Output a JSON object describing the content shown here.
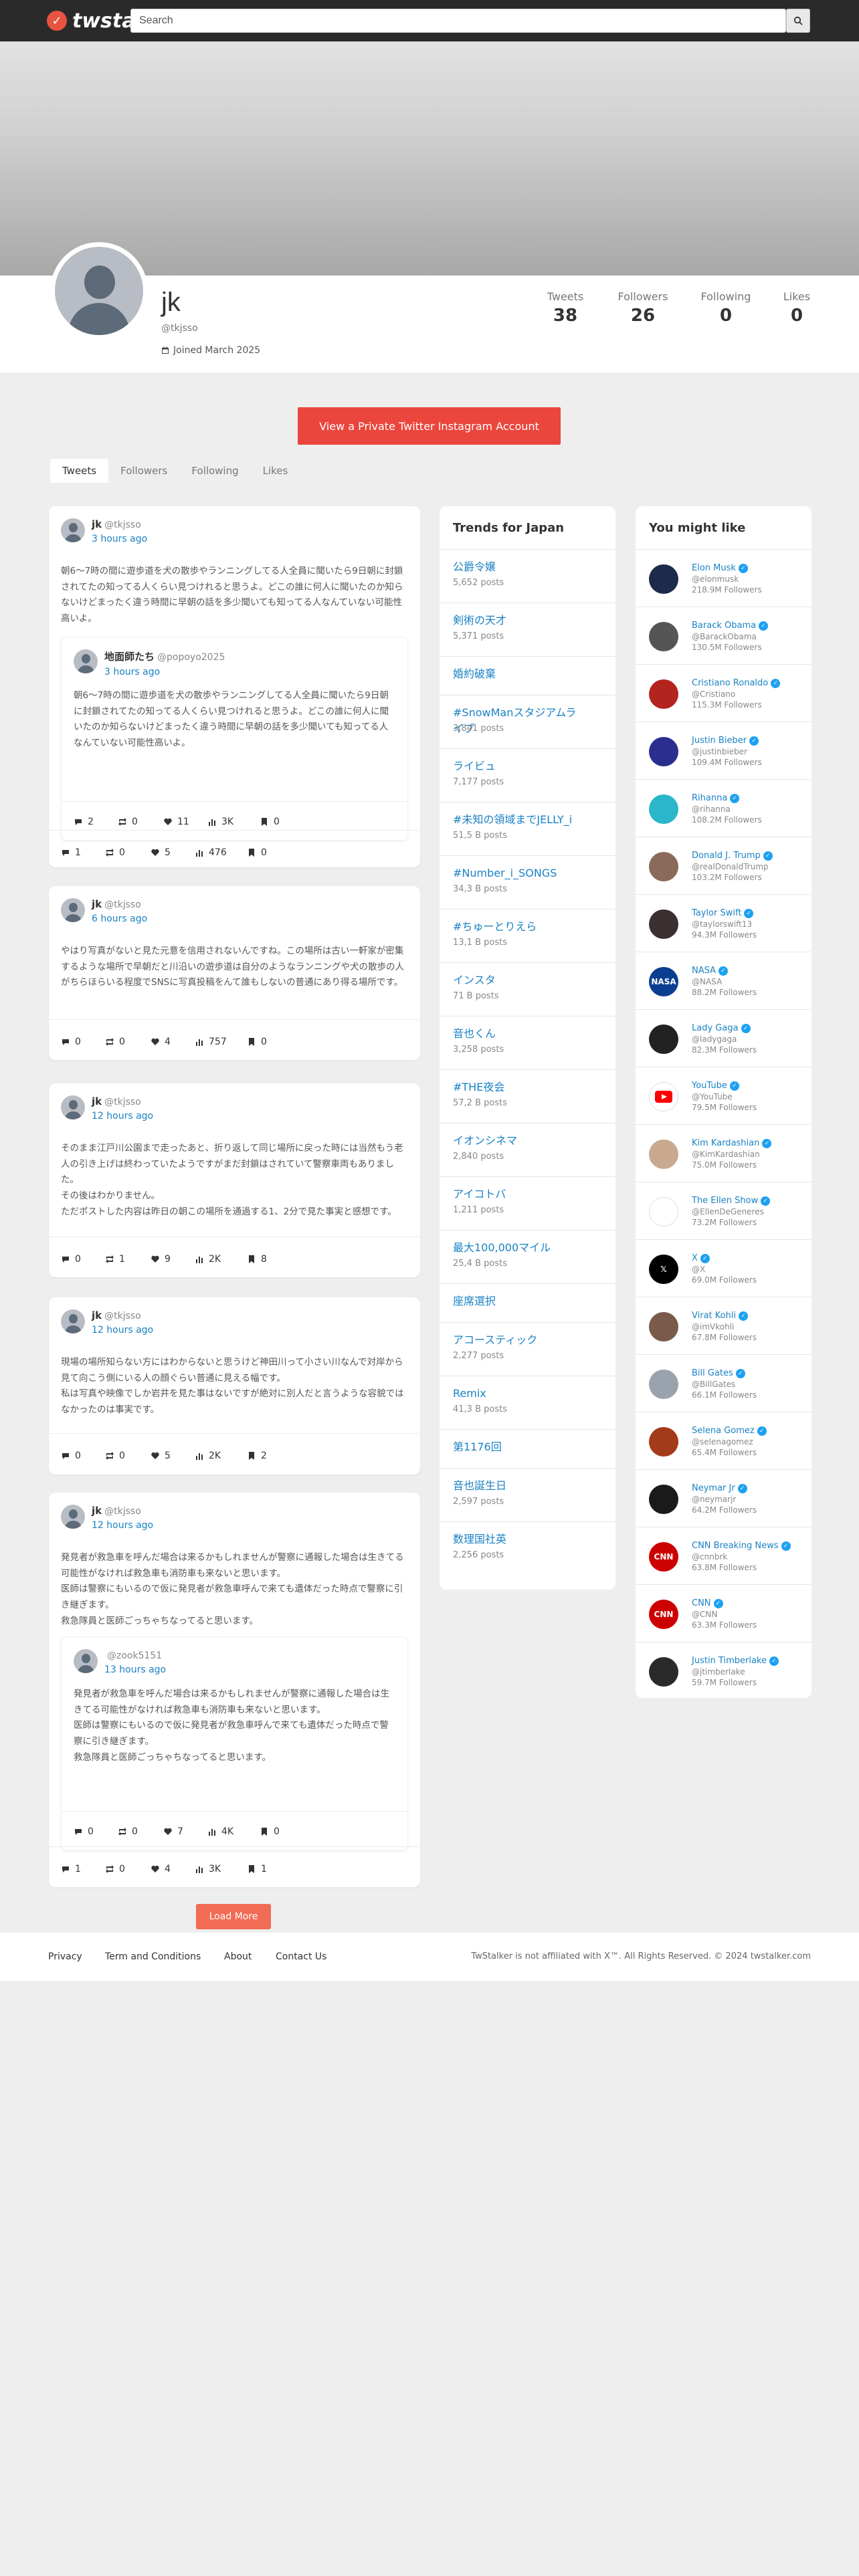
{
  "header": {
    "logo_text": "twstalker",
    "search_placeholder": "Search",
    "search_icon": "search-icon"
  },
  "profile": {
    "name": "jk",
    "handle": "@tkjsso",
    "joined": "Joined March 2025",
    "stats": [
      {
        "label": "Tweets",
        "value": "38"
      },
      {
        "label": "Followers",
        "value": "26"
      },
      {
        "label": "Following",
        "value": "0"
      },
      {
        "label": "Likes",
        "value": "0"
      }
    ]
  },
  "cta": "View a Private Twitter Instagram Account",
  "tabs": [
    "Tweets",
    "Followers",
    "Following",
    "Likes"
  ],
  "tweets": [
    {
      "name": "jk",
      "handle": "@tkjsso",
      "time": "3 hours ago",
      "text": "朝6〜7時の間に遊歩道を犬の散歩やランニングしてる人全員に聞いたら9日朝に封鎖されてたの知ってる人くらい見つけれると思うよ。どこの誰に何人に聞いたのか知らないけどまったく違う時間に早朝の話を多少聞いても知ってる人なんていない可能性高いよ。",
      "quote": {
        "name": "地面師たち",
        "handle": "@popoyo2025",
        "time": "3 hours ago",
        "text": "朝6〜7時の間に遊歩道を犬の散歩やランニングしてる人全員に聞いたら9日朝に封鎖されてたの知ってる人くらい見つけれると思うよ。どこの誰に何人に聞いたのか知らないけどまったく違う時間に早朝の話を多少聞いても知ってる人なんていない可能性高いよ。",
        "stats": {
          "replies": "2",
          "retweets": "0",
          "likes": "11",
          "views": "3K",
          "bookmarks": "0"
        }
      },
      "stats": {
        "replies": "1",
        "retweets": "0",
        "likes": "5",
        "views": "476",
        "bookmarks": "0"
      }
    },
    {
      "name": "jk",
      "handle": "@tkjsso",
      "time": "6 hours ago",
      "text": "やはり写真がないと見た元意を信用されないんですね。この場所は古い一軒家が密集するような場所で早朝だと川沿いの遊歩道は自分のようなランニングや犬の散歩の人がちらほらいる程度でSNSに写真投稿をんて誰もしないの普通にあり得る場所です。",
      "stats": {
        "replies": "0",
        "retweets": "0",
        "likes": "4",
        "views": "757",
        "bookmarks": "0"
      }
    },
    {
      "name": "jk",
      "handle": "@tkjsso",
      "time": "12 hours ago",
      "text": "そのまま江戸川公園まで走ったあと、折り返して同じ場所に戻った時には当然もう老人の引き上げは終わっていたようですがまだ封鎖はされていて警察車両もありました。\nその後はわかりません。\nただポストした内容は昨日の朝この場所を通過する1、2分で見た事実と感想です。",
      "stats": {
        "replies": "0",
        "retweets": "1",
        "likes": "9",
        "views": "2K",
        "bookmarks": "8"
      }
    },
    {
      "name": "jk",
      "handle": "@tkjsso",
      "time": "12 hours ago",
      "text": "現場の場所知らない方にはわからないと思うけど神田川って小さい川なんで対岸から見て向こう側にいる人の顔ぐらい普通に見える幅です。\n私は写真や映像でしか岩井を見た事はないですが絶対に別人だと言うような容貌ではなかったのは事実です。",
      "stats": {
        "replies": "0",
        "retweets": "0",
        "likes": "5",
        "views": "2K",
        "bookmarks": "2"
      }
    },
    {
      "name": "jk",
      "handle": "@tkjsso",
      "time": "12 hours ago",
      "text": "発見者が救急車を呼んだ場合は来るかもしれませんが警察に通報した場合は生きてる可能性がなければ救急車も消防車も来ないと思います。\n医師は警察にもいるので仮に発見者が救急車呼んで来ても遺体だった時点で警察に引き継ぎます。\n救急隊員と医師ごっちゃちなってると思います。",
      "quote": {
        "name": "",
        "handle": "@zook5151",
        "time": "13 hours ago",
        "text": "発見者が救急車を呼んだ場合は来るかもしれませんが警察に通報した場合は生きてる可能性がなければ救急車も消防車も来ないと思います。\n医師は警察にもいるので仮に発見者が救急車呼んで来ても遺体だった時点で警察に引き継ぎます。\n救急隊員と医師ごっちゃちなってると思います。",
        "stats": {
          "replies": "0",
          "retweets": "0",
          "likes": "7",
          "views": "4K",
          "bookmarks": "0"
        }
      },
      "stats": {
        "replies": "1",
        "retweets": "0",
        "likes": "4",
        "views": "3K",
        "bookmarks": "1"
      }
    }
  ],
  "trends": {
    "title": "Trends for Japan",
    "items": [
      {
        "name": "公爵令嬢",
        "count": "5,652 posts"
      },
      {
        "name": "剣術の天才",
        "count": "5,371 posts"
      },
      {
        "name": "婚約破棄",
        "count": ""
      },
      {
        "name": "#SnowManスタジアムライブ",
        "count": "3,841 posts"
      },
      {
        "name": "ライビュ",
        "count": "7,177 posts"
      },
      {
        "name": "#未知の領域までJELLY_i",
        "count": "51,5 B posts"
      },
      {
        "name": "#Number_i_SONGS",
        "count": "34,3 B posts"
      },
      {
        "name": "#ちゅーとりえら",
        "count": "13,1 B posts"
      },
      {
        "name": "インスタ",
        "count": "71 B posts"
      },
      {
        "name": "音也くん",
        "count": "3,258 posts"
      },
      {
        "name": "#THE夜会",
        "count": "57,2 B posts"
      },
      {
        "name": "イオンシネマ",
        "count": "2,840 posts"
      },
      {
        "name": "アイコトバ",
        "count": "1,211 posts"
      },
      {
        "name": "最大100,000マイル",
        "count": "25,4 B posts"
      },
      {
        "name": "座席選択",
        "count": ""
      },
      {
        "name": "アコースティック",
        "count": "2,277 posts"
      },
      {
        "name": "Remix",
        "count": "41,3 B posts"
      },
      {
        "name": "第1176回",
        "count": ""
      },
      {
        "name": "音也誕生日",
        "count": "2,597 posts"
      },
      {
        "name": "数理国社英",
        "count": "2,256 posts"
      }
    ]
  },
  "suggestions": {
    "title": "You might like",
    "items": [
      {
        "name": "Elon Musk",
        "handle": "@elonmusk",
        "followers": "218.9M Followers",
        "color": "#1d2a4a"
      },
      {
        "name": "Barack Obama",
        "handle": "@BarackObama",
        "followers": "130.5M Followers",
        "color": "#555555"
      },
      {
        "name": "Cristiano Ronaldo",
        "handle": "@Cristiano",
        "followers": "115.3M Followers",
        "color": "#b3241f"
      },
      {
        "name": "Justin Bieber",
        "handle": "@justinbieber",
        "followers": "109.4M Followers",
        "color": "#2a2f8f"
      },
      {
        "name": "Rihanna",
        "handle": "@rihanna",
        "followers": "108.2M Followers",
        "color": "#2ab7c9"
      },
      {
        "name": "Donald J. Trump",
        "handle": "@realDonaldTrump",
        "followers": "103.2M Followers",
        "color": "#8a6a5a"
      },
      {
        "name": "Taylor Swift",
        "handle": "@taylorswift13",
        "followers": "94.3M Followers",
        "color": "#3a3030"
      },
      {
        "name": "NASA",
        "handle": "@NASA",
        "followers": "88.2M Followers",
        "color": "#0b3d91"
      },
      {
        "name": "Lady Gaga",
        "handle": "@ladygaga",
        "followers": "82.3M Followers",
        "color": "#222222"
      },
      {
        "name": "YouTube",
        "handle": "@YouTube",
        "followers": "79.5M Followers",
        "color": "#ffffff"
      },
      {
        "name": "Kim Kardashian",
        "handle": "@KimKardashian",
        "followers": "75.0M Followers",
        "color": "#c9a98f"
      },
      {
        "name": "The Ellen Show",
        "handle": "@EllenDeGeneres",
        "followers": "73.2M Followers",
        "color": "#ffffff"
      },
      {
        "name": "X",
        "handle": "@X",
        "followers": "69.0M Followers",
        "color": "#000000"
      },
      {
        "name": "Virat Kohli",
        "handle": "@imVkohli",
        "followers": "67.8M Followers",
        "color": "#7a5a4a"
      },
      {
        "name": "Bill Gates",
        "handle": "@BillGates",
        "followers": "66.1M Followers",
        "color": "#9aa3ad"
      },
      {
        "name": "Selena Gomez",
        "handle": "@selenagomez",
        "followers": "65.4M Followers",
        "color": "#a33a1a"
      },
      {
        "name": "Neymar Jr",
        "handle": "@neymarjr",
        "followers": "64.2M Followers",
        "color": "#1a1a1a"
      },
      {
        "name": "CNN Breaking News",
        "handle": "@cnnbrk",
        "followers": "63.8M Followers",
        "color": "#cc0000"
      },
      {
        "name": "CNN",
        "handle": "@CNN",
        "followers": "63.3M Followers",
        "color": "#cc0000"
      },
      {
        "name": "Justin Timberlake",
        "handle": "@jtimberlake",
        "followers": "59.7M Followers",
        "color": "#2a2a2a"
      }
    ]
  },
  "load_more": "Load More",
  "footer": {
    "links": [
      "Privacy",
      "Term and Conditions",
      "About",
      "Contact Us"
    ],
    "copyright": "TwStalker is not affiliated with X™. All Rights Reserved. © 2024 twstalker.com"
  },
  "colors": {
    "accent": "#ea463d",
    "link": "#1a82c4",
    "load_more": "#f26b55",
    "topbar": "#2a2a2a"
  }
}
